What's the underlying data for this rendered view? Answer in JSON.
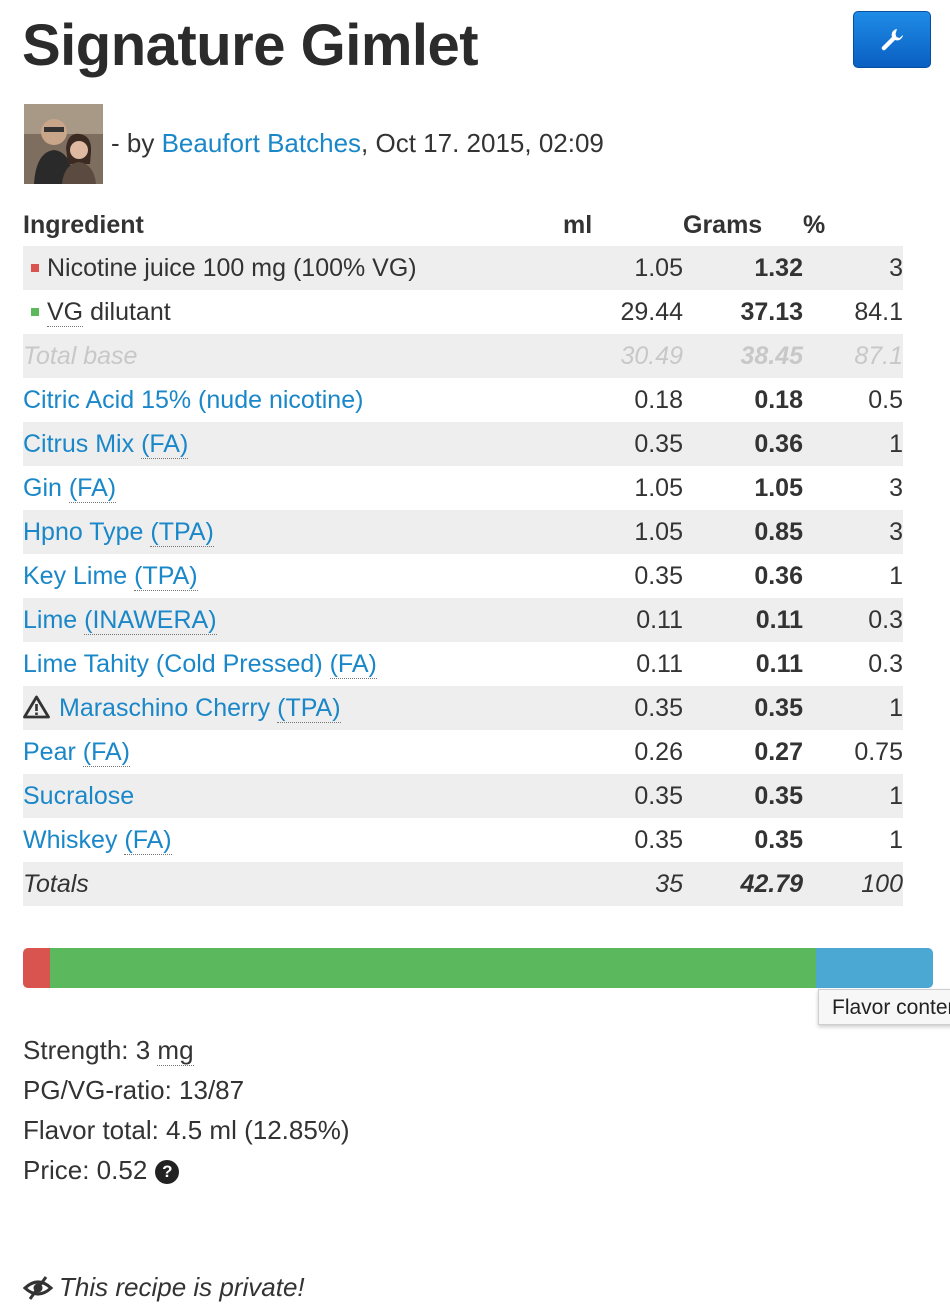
{
  "title": "Signature Gimlet",
  "byline": {
    "prefix": "- by ",
    "author": "Beaufort Batches",
    "date": ", Oct 17. 2015, 02:09"
  },
  "table": {
    "headers": {
      "ingredient": "Ingredient",
      "ml": "ml",
      "grams": "Grams",
      "pct": "%"
    },
    "base_rows": [
      {
        "name": "Nicotine juice 100 mg (100% VG)",
        "color": "#d9534f",
        "ml": "1.05",
        "grams": "1.32",
        "pct": "3"
      },
      {
        "name": "VG dilutant",
        "color": "#5cb85c",
        "ml": "29.44",
        "grams": "37.13",
        "pct": "84.1"
      }
    ],
    "total_base": {
      "name": "Total base",
      "ml": "30.49",
      "grams": "38.45",
      "pct": "87.1"
    },
    "flavors": [
      {
        "name": "Citric Acid 15% (nude nicotine)",
        "vendor": "",
        "ml": "0.18",
        "grams": "0.18",
        "pct": "0.5"
      },
      {
        "name": "Citrus Mix ",
        "vendor": "(FA)",
        "ml": "0.35",
        "grams": "0.36",
        "pct": "1"
      },
      {
        "name": "Gin ",
        "vendor": "(FA)",
        "ml": "1.05",
        "grams": "1.05",
        "pct": "3"
      },
      {
        "name": "Hpno Type ",
        "vendor": "(TPA)",
        "ml": "1.05",
        "grams": "0.85",
        "pct": "3"
      },
      {
        "name": "Key Lime ",
        "vendor": "(TPA)",
        "ml": "0.35",
        "grams": "0.36",
        "pct": "1"
      },
      {
        "name": "Lime ",
        "vendor": "(INAWERA)",
        "ml": "0.11",
        "grams": "0.11",
        "pct": "0.3"
      },
      {
        "name": "Lime Tahity (Cold Pressed) ",
        "vendor": "(FA)",
        "ml": "0.11",
        "grams": "0.11",
        "pct": "0.3"
      },
      {
        "name": "Maraschino Cherry ",
        "vendor": "(TPA)",
        "ml": "0.35",
        "grams": "0.35",
        "pct": "1",
        "warning": true
      },
      {
        "name": "Pear ",
        "vendor": "(FA)",
        "ml": "0.26",
        "grams": "0.27",
        "pct": "0.75"
      },
      {
        "name": "Sucralose",
        "vendor": "",
        "ml": "0.35",
        "grams": "0.35",
        "pct": "1"
      },
      {
        "name": "Whiskey ",
        "vendor": "(FA)",
        "ml": "0.35",
        "grams": "0.35",
        "pct": "1"
      }
    ],
    "totals": {
      "label": "Totals",
      "ml": "35",
      "grams": "42.79",
      "pct": "100"
    }
  },
  "composition_bar": {
    "segments": [
      {
        "name": "nicotine",
        "percent": 3,
        "color": "#d9534f"
      },
      {
        "name": "vg-dilutant",
        "percent": 84.1,
        "color": "#5cb85c"
      },
      {
        "name": "flavor",
        "percent": 12.9,
        "color": "#4aa8d3"
      }
    ],
    "tooltip": "Flavor content"
  },
  "stats": {
    "strength_label": "Strength: 3 ",
    "strength_unit": "mg",
    "ratio": "PG/VG-ratio: 13/87",
    "flavor_total": "Flavor total: 4.5 ml (12.85%)",
    "price": "Price: 0.52",
    "help_icon": "question-circle-icon"
  },
  "privacy": {
    "icon": "eye-slash-icon",
    "text": "This recipe is private!"
  }
}
